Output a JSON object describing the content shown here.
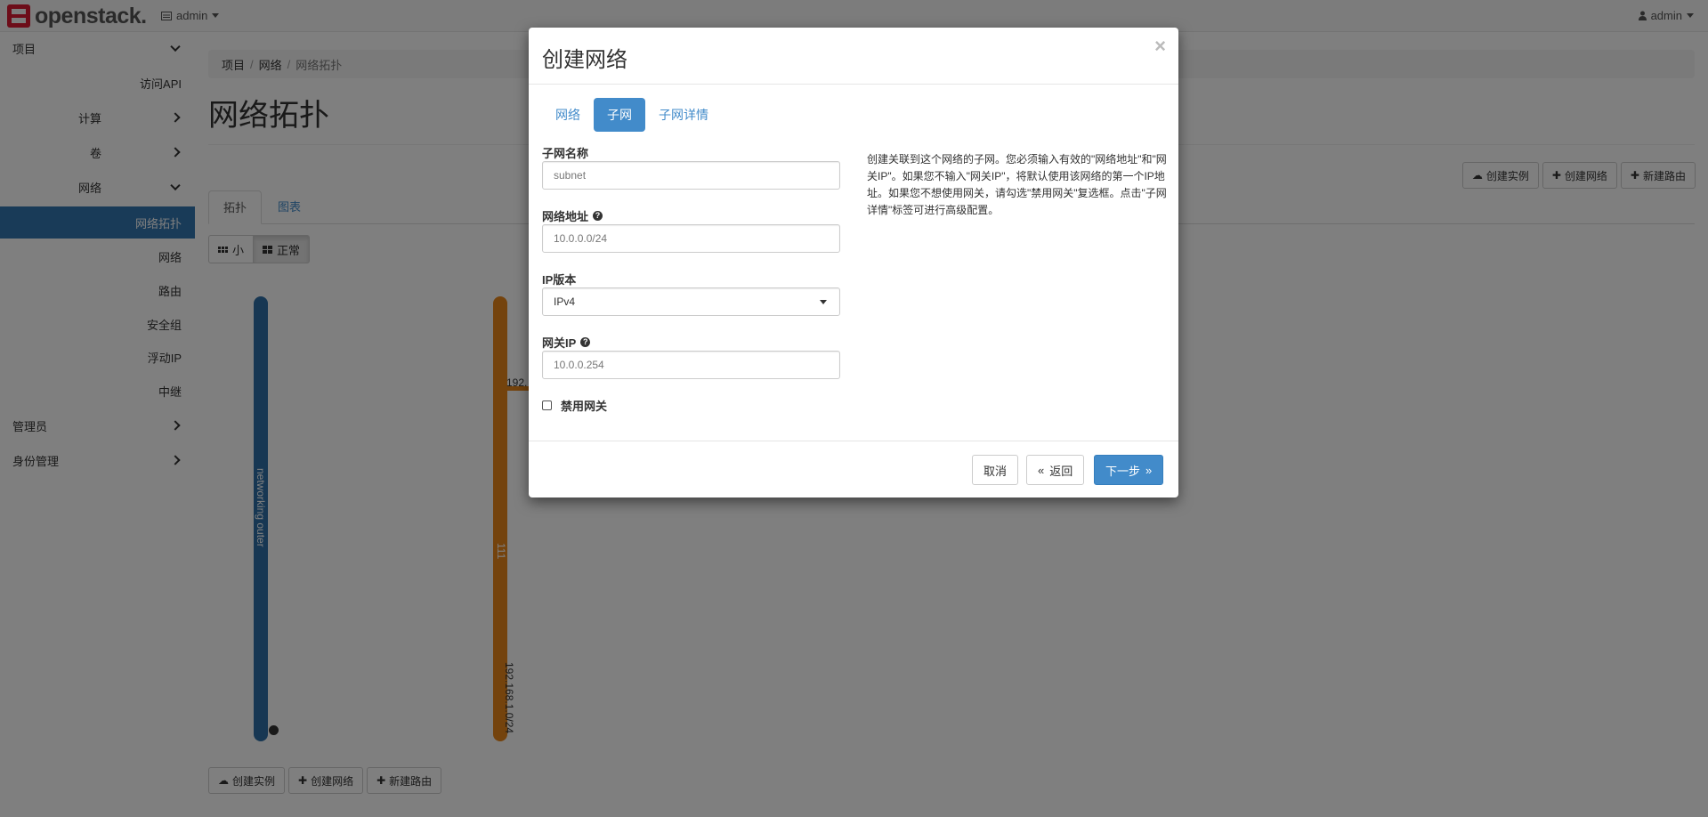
{
  "navbar": {
    "brand": "openstack.",
    "project_menu": "admin",
    "user_menu": "admin"
  },
  "sidebar": {
    "items": [
      {
        "label": "项目",
        "level": 0,
        "chevron": "down"
      },
      {
        "label": "访问API",
        "level": 2
      },
      {
        "label": "计算",
        "level": 1,
        "chevron": "right"
      },
      {
        "label": "卷",
        "level": 1,
        "chevron": "right"
      },
      {
        "label": "网络",
        "level": 1,
        "chevron": "down"
      },
      {
        "label": "网络拓扑",
        "level": 2,
        "active": true
      },
      {
        "label": "网络",
        "level": 2
      },
      {
        "label": "路由",
        "level": 2
      },
      {
        "label": "安全组",
        "level": 2
      },
      {
        "label": "浮动IP",
        "level": 2
      },
      {
        "label": "中继",
        "level": 2
      },
      {
        "label": "管理员",
        "level": 0,
        "chevron": "right"
      },
      {
        "label": "身份管理",
        "level": 0,
        "chevron": "right"
      }
    ]
  },
  "breadcrumb": [
    "项目",
    "网络",
    "网络拓扑"
  ],
  "page_title": "网络拓扑",
  "actions": {
    "launch_instance": "创建实例",
    "create_network": "创建网络",
    "create_router": "新建路由"
  },
  "tabs": {
    "topology": "拓扑",
    "graph": "图表"
  },
  "view_toggle": {
    "small": "小",
    "normal": "正常"
  },
  "topology": {
    "networks": [
      {
        "name": "networking outer",
        "color": "#2f6fa7"
      },
      {
        "name": "111",
        "color": "#e8861a",
        "subnet": "192.168.1.0/24",
        "port_label": "192."
      }
    ]
  },
  "modal": {
    "title": "创建网络",
    "close": "×",
    "wizard_tabs": [
      "网络",
      "子网",
      "子网详情"
    ],
    "active_tab": 1,
    "fields": {
      "subnet_name_label": "子网名称",
      "subnet_name_value": "subnet",
      "network_address_label": "网络地址",
      "network_address_value": "10.0.0.0/24",
      "ip_version_label": "IP版本",
      "ip_version_value": "IPv4",
      "gateway_ip_label": "网关IP",
      "gateway_ip_value": "10.0.0.254",
      "disable_gateway_label": "禁用网关"
    },
    "help_text": "创建关联到这个网络的子网。您必须输入有效的\"网络地址\"和\"网关IP\"。如果您不输入\"网关IP\"，将默认使用该网络的第一个IP地址。如果您不想使用网关，请勾选\"禁用网关\"复选框。点击\"子网详情\"标签可进行高级配置。",
    "buttons": {
      "cancel": "取消",
      "back": "返回",
      "back_icon": "«",
      "next": "下一步",
      "next_icon": "»"
    }
  }
}
